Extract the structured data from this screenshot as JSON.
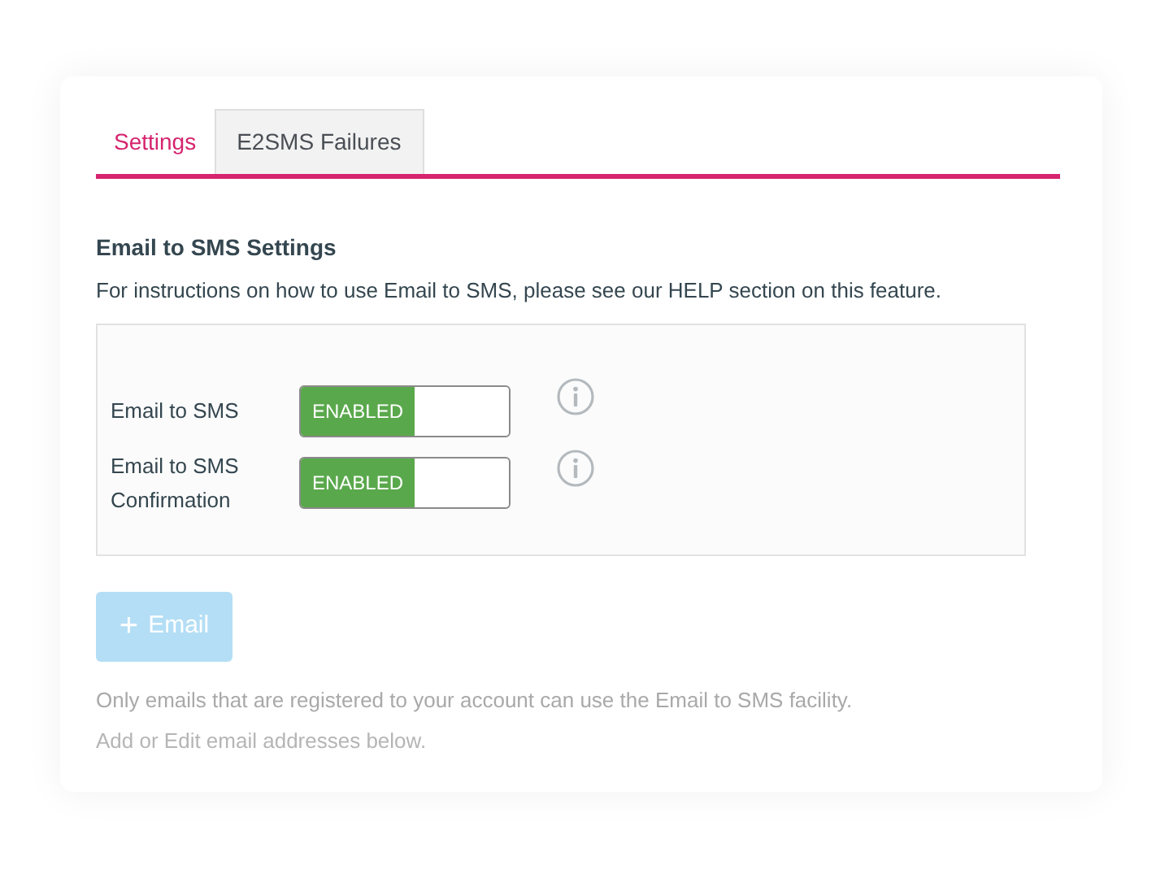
{
  "tabs": [
    {
      "label": "Settings",
      "selected": true
    },
    {
      "label": "E2SMS Failures",
      "selected": false
    }
  ],
  "section": {
    "title": "Email to SMS Settings",
    "description": "For instructions on how to use Email to SMS, please see our HELP section on this feature."
  },
  "settings": [
    {
      "label": "Email to SMS",
      "toggle_label": "ENABLED",
      "on": true
    },
    {
      "label": "Email to SMS Confirmation",
      "toggle_label": "ENABLED",
      "on": true
    }
  ],
  "add_button": {
    "icon": "+",
    "label": "Email",
    "disabled": true
  },
  "notes": [
    "Only emails that are registered to your account can use the Email to SMS facility.",
    "Add or Edit email addresses below."
  ]
}
